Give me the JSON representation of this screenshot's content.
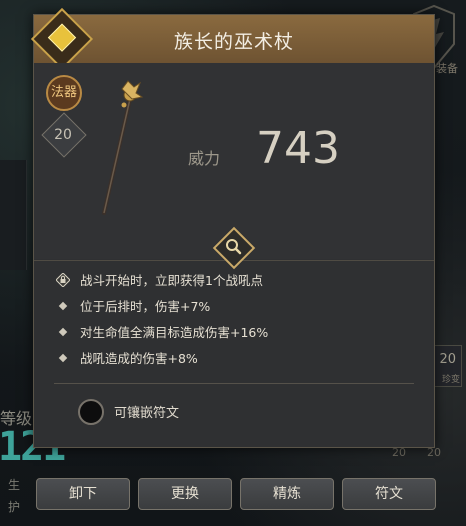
{
  "item": {
    "name": "族长的巫术杖",
    "type_badge": "法器",
    "level": "20",
    "power_label": "威力",
    "power_value": "743"
  },
  "effects": [
    {
      "text": "战斗开始时，立即获得1个战吼点",
      "bullet": "lock-icon"
    },
    {
      "text": "位于后排时，伤害+7%",
      "bullet": "diamond-icon"
    },
    {
      "text": "对生命值全满目标造成伤害+16%",
      "bullet": "diamond-icon"
    },
    {
      "text": "战吼造成的伤害+8%",
      "bullet": "diamond-icon"
    }
  ],
  "rune_socket": {
    "label": "可镶嵌符文"
  },
  "actions": {
    "unequip": "卸下",
    "swap": "更换",
    "refine": "精炼",
    "rune": "符文"
  },
  "background": {
    "level_label": "等级",
    "level_value": "121",
    "corner_text": "装备",
    "badge_num": "20",
    "badge_text": "珍变",
    "num_a": "20",
    "num_b": "20",
    "stat1": "生",
    "stat2": "护"
  },
  "colors": {
    "header_gold": "#8a6a3f",
    "rarity_gem": "#e8c23c",
    "panel_bg": "#2f3032",
    "accent_teal": "#3ea39a"
  }
}
